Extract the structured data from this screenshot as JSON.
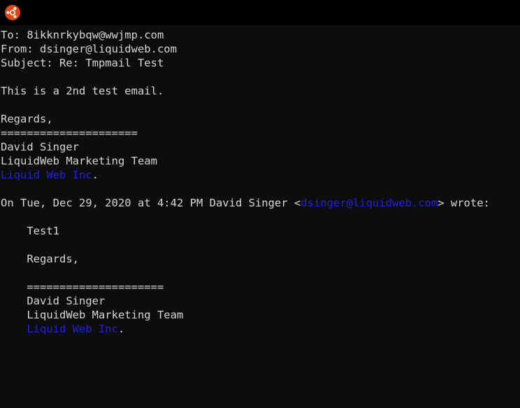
{
  "window": {
    "title_bar_color": "#000000",
    "body_background": "#0d0d0d",
    "text_color": "#d6d6d6",
    "link_color": "#2222dd",
    "logo_color": "#dd4814",
    "logo_name": "ubuntu-logo-icon"
  },
  "email": {
    "headers": {
      "to_line": "To: 8ikknrkybqw@wwjmp.com",
      "from_line": "From: dsinger@liquidweb.com",
      "subject_line": "Subject: Re: Tmpmail Test"
    },
    "body": {
      "message": "This is a 2nd test email.",
      "closing": "Regards,",
      "separator": "=====================",
      "signature_name": "David Singer",
      "signature_team": "LiquidWeb Marketing Team",
      "signature_company": "Liquid Web Inc",
      "signature_company_period": "."
    },
    "quote_attribution": {
      "prefix": "On Tue, Dec 29, 2020 at 4:42 PM David Singer <",
      "email": "dsinger@liquidweb.com",
      "suffix": "> wrote:"
    },
    "quoted": {
      "message": "    Test1",
      "closing": "    Regards,",
      "separator": "    =====================",
      "signature_name": "    David Singer",
      "signature_team": "    LiquidWeb Marketing Team",
      "signature_company_indent": "    ",
      "signature_company": "Liquid Web Inc",
      "signature_company_period": "."
    }
  }
}
